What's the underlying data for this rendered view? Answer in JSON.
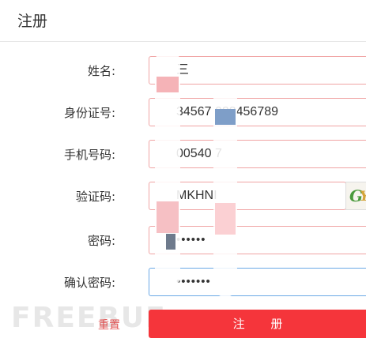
{
  "header": {
    "title": "注册"
  },
  "form": {
    "name": {
      "label": "姓名:",
      "value": "三"
    },
    "id_card": {
      "label": "身份证号:",
      "value": "34567   023456789"
    },
    "phone": {
      "label": "手机号码:",
      "value": "00540   7"
    },
    "captcha": {
      "label": "验证码:",
      "value": "MKHNI",
      "image_text_1": "G",
      "image_text_2": "Y"
    },
    "password": {
      "label": "密码:",
      "value": "••••••"
    },
    "confirm_password": {
      "label": "确认密码:",
      "value": "•••••••"
    }
  },
  "actions": {
    "reset_label": "重置",
    "submit_label": "注 册"
  },
  "watermark": "FREEBUF",
  "colors": {
    "accent_red": "#f5353b",
    "field_border": "#f0a4a4",
    "focus_border": "#6aa9e6"
  }
}
